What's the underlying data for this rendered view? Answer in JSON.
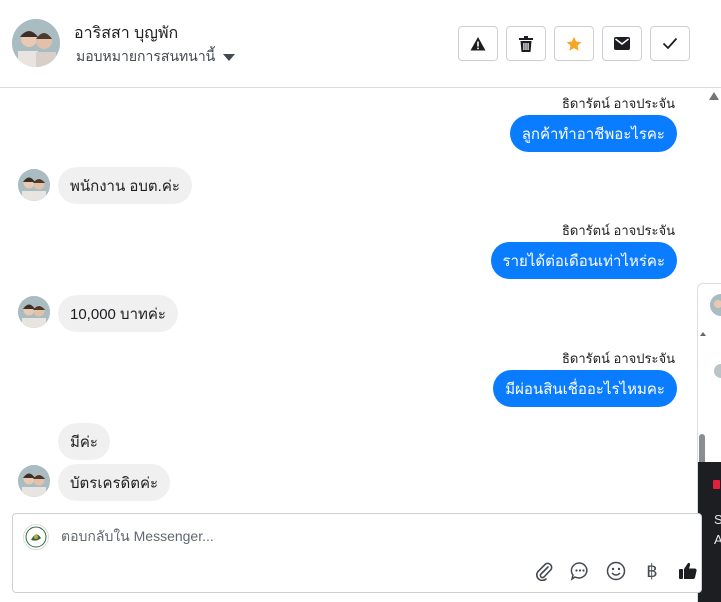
{
  "header": {
    "contact_name": "อาริสสา บุญพัก",
    "assign_label": "มอบหมายการสนทนานี้",
    "actions": [
      "spam",
      "delete",
      "star",
      "unread",
      "done"
    ]
  },
  "messages": [
    {
      "dir": "out",
      "sender": "ธิดารัตน์ อาจประจัน",
      "text": "ลูกค้าทำอาชีพอะไรคะ"
    },
    {
      "dir": "in",
      "text": "พนักงาน อบต.ค่ะ"
    },
    {
      "dir": "out",
      "sender": "ธิดารัตน์ อาจประจัน",
      "text": "รายได้ต่อเดือนเท่าไหร่คะ"
    },
    {
      "dir": "in",
      "text": "10,000 บาทค่ะ"
    },
    {
      "dir": "out",
      "sender": "ธิดารัตน์ อาจประจัน",
      "text": "มีผ่อนสินเชื่ออะไรไหมคะ"
    },
    {
      "dir": "in",
      "text": "มีค่ะ"
    },
    {
      "dir": "in",
      "text": "บัตรเครดิตค่ะ"
    }
  ],
  "composer": {
    "placeholder": "ตอบกลับใน Messenger...",
    "tools": [
      "paperclip-icon",
      "chat-bubble-icon",
      "smiley-icon",
      "baht-icon",
      "thumbs-up-icon"
    ]
  },
  "side_panel": {
    "text_line1": "S",
    "text_line2": "A"
  },
  "colors": {
    "outgoing_bubble": "#0a7cff",
    "incoming_bubble": "#f0f0f0",
    "star": "#f5a623"
  }
}
